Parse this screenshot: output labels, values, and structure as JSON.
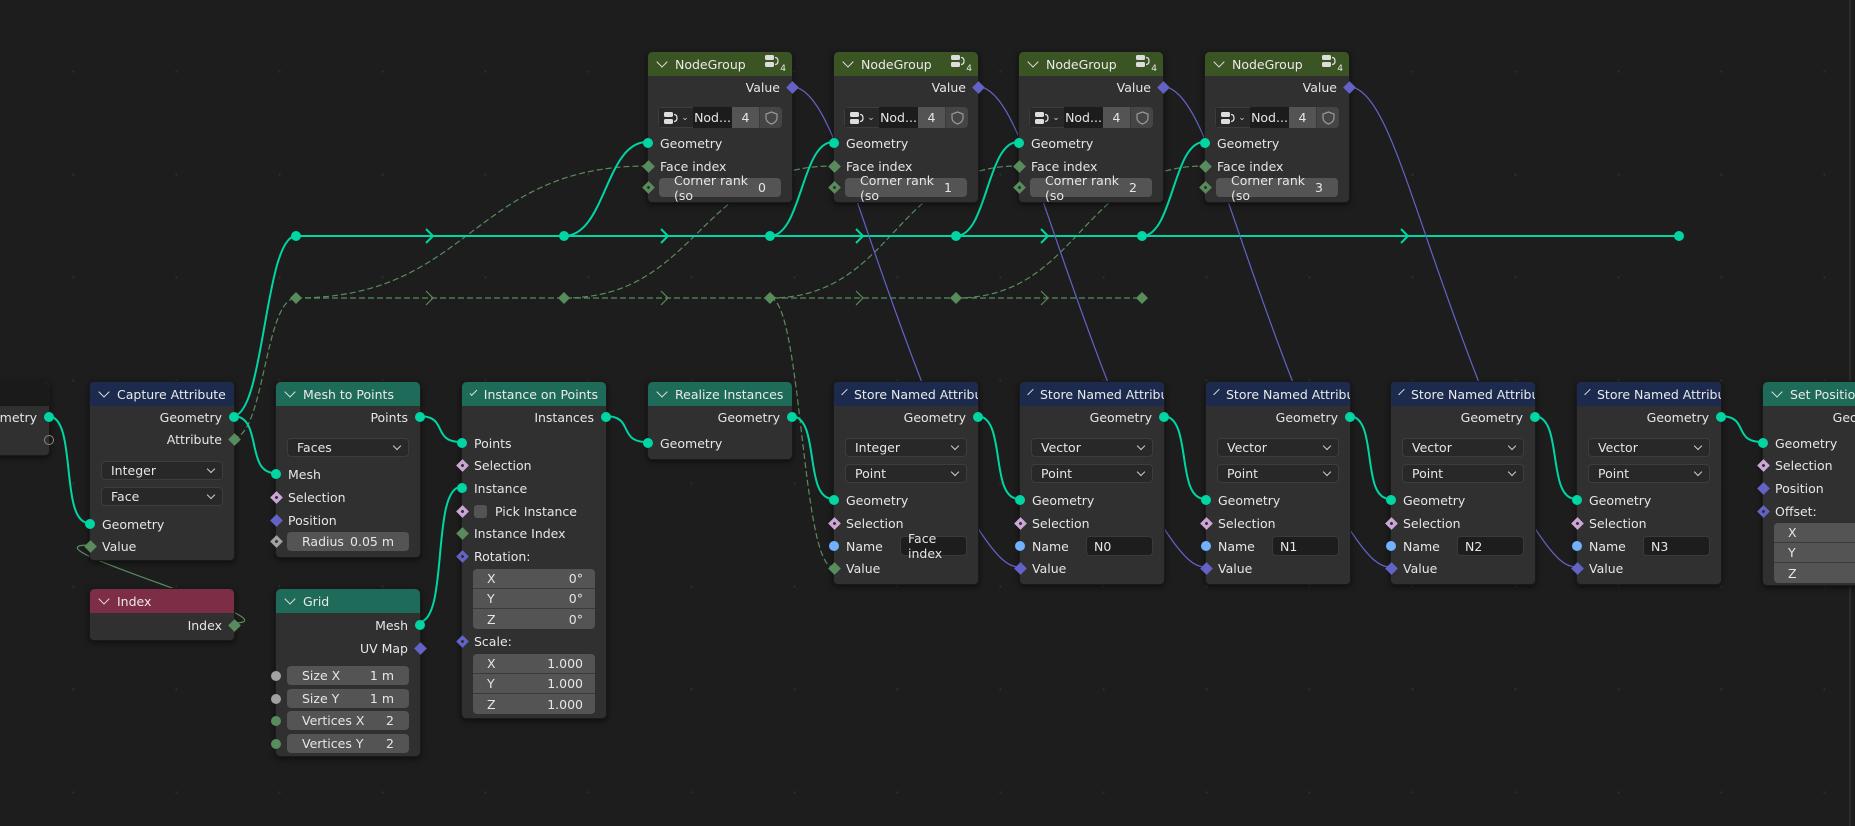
{
  "colors": {
    "background": "#1d1d1d",
    "geometry_socket": "#00d6a3",
    "integer_socket": "#598c5c",
    "vector_socket": "#6363c7",
    "boolean_socket": "#cca6d6",
    "string_socket": "#70b2ff",
    "float_socket": "#a1a1a1",
    "geometry_header": "#1f6b59",
    "attribute_header": "#1c2a4e",
    "input_header": "#7d2d46",
    "group_header": "#3b5424"
  },
  "group_input": {
    "outputs": [
      "Geometry"
    ]
  },
  "capture_attribute": {
    "title": "Capture Attribute",
    "outputs": [
      "Geometry",
      "Attribute"
    ],
    "data_type": "Integer",
    "domain": "Face",
    "inputs": [
      "Geometry",
      "Value"
    ]
  },
  "index_node": {
    "title": "Index",
    "output": "Index"
  },
  "mesh_to_points": {
    "title": "Mesh to Points",
    "output": "Points",
    "mode": "Faces",
    "inputs": [
      "Mesh",
      "Selection",
      "Position"
    ],
    "radius_label": "Radius",
    "radius_value": "0.05 m"
  },
  "grid": {
    "title": "Grid",
    "outputs": [
      "Mesh",
      "UV Map"
    ],
    "fields": [
      {
        "label": "Size X",
        "value": "1 m"
      },
      {
        "label": "Size Y",
        "value": "1 m"
      },
      {
        "label": "Vertices X",
        "value": "2"
      },
      {
        "label": "Vertices Y",
        "value": "2"
      }
    ]
  },
  "instance_on_points": {
    "title": "Instance on Points",
    "output": "Instances",
    "inputs": [
      "Points",
      "Selection",
      "Instance",
      "Pick Instance",
      "Instance Index"
    ],
    "rotation_label": "Rotation:",
    "rotation": [
      {
        "axis": "X",
        "value": "0°"
      },
      {
        "axis": "Y",
        "value": "0°"
      },
      {
        "axis": "Z",
        "value": "0°"
      }
    ],
    "scale_label": "Scale:",
    "scale": [
      {
        "axis": "X",
        "value": "1.000"
      },
      {
        "axis": "Y",
        "value": "1.000"
      },
      {
        "axis": "Z",
        "value": "1.000"
      }
    ]
  },
  "realize_instances": {
    "title": "Realize Instances",
    "output": "Geometry",
    "input": "Geometry"
  },
  "node_groups": [
    {
      "title": "NodeGroup",
      "output": "Value",
      "group_name": "Nod...",
      "users": "4",
      "badge": "4",
      "inputs": [
        "Geometry",
        "Face index"
      ],
      "corner_label": "Corner rank (so",
      "corner_value": "0"
    },
    {
      "title": "NodeGroup",
      "output": "Value",
      "group_name": "Nod...",
      "users": "4",
      "badge": "4",
      "inputs": [
        "Geometry",
        "Face index"
      ],
      "corner_label": "Corner rank (so",
      "corner_value": "1"
    },
    {
      "title": "NodeGroup",
      "output": "Value",
      "group_name": "Nod...",
      "users": "4",
      "badge": "4",
      "inputs": [
        "Geometry",
        "Face index"
      ],
      "corner_label": "Corner rank (so",
      "corner_value": "2"
    },
    {
      "title": "NodeGroup",
      "output": "Value",
      "group_name": "Nod...",
      "users": "4",
      "badge": "4",
      "inputs": [
        "Geometry",
        "Face index"
      ],
      "corner_label": "Corner rank (so",
      "corner_value": "3"
    }
  ],
  "store_named": [
    {
      "title": "Store Named Attribute",
      "output": "Geometry",
      "data_type": "Integer",
      "domain": "Point",
      "inputs": [
        "Geometry",
        "Selection",
        "Name",
        "Value"
      ],
      "name_value": "Face index"
    },
    {
      "title": "Store Named Attribute",
      "output": "Geometry",
      "data_type": "Vector",
      "domain": "Point",
      "inputs": [
        "Geometry",
        "Selection",
        "Name",
        "Value"
      ],
      "name_value": "N0"
    },
    {
      "title": "Store Named Attribute",
      "output": "Geometry",
      "data_type": "Vector",
      "domain": "Point",
      "inputs": [
        "Geometry",
        "Selection",
        "Name",
        "Value"
      ],
      "name_value": "N1"
    },
    {
      "title": "Store Named Attribute",
      "output": "Geometry",
      "data_type": "Vector",
      "domain": "Point",
      "inputs": [
        "Geometry",
        "Selection",
        "Name",
        "Value"
      ],
      "name_value": "N2"
    },
    {
      "title": "Store Named Attribute",
      "output": "Geometry",
      "data_type": "Vector",
      "domain": "Point",
      "inputs": [
        "Geometry",
        "Selection",
        "Name",
        "Value"
      ],
      "name_value": "N3"
    }
  ],
  "set_position": {
    "title": "Set Position",
    "output": "Geometry",
    "inputs": [
      "Geometry",
      "Selection",
      "Position"
    ],
    "offset_label": "Offset:",
    "offset_axes": [
      "X",
      "Y",
      "Z"
    ]
  }
}
